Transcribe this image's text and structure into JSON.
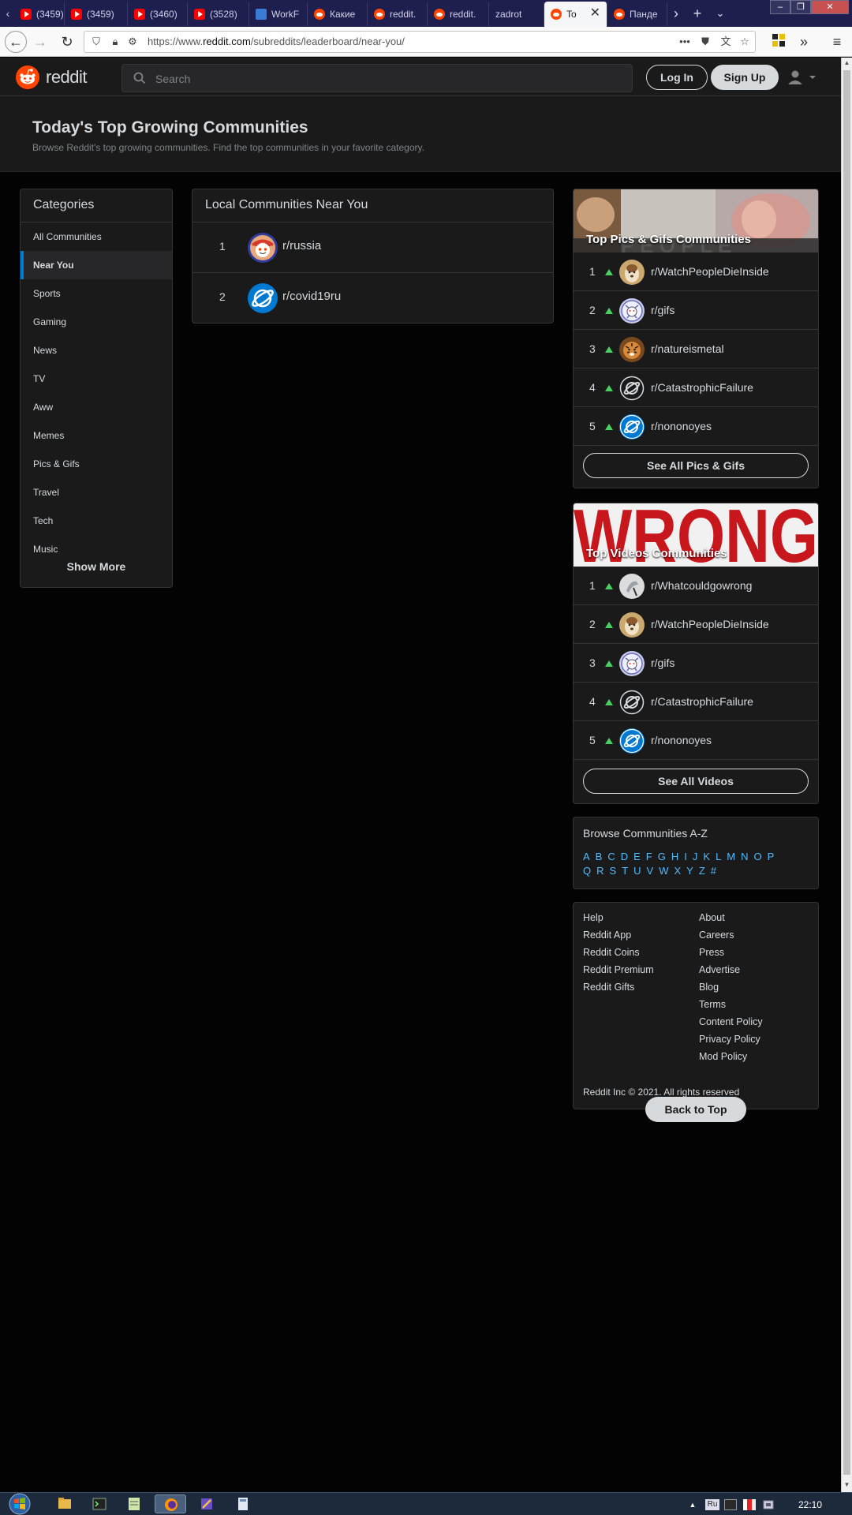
{
  "browser": {
    "tabs": [
      {
        "label": "(3459)",
        "favicon": "youtube-icon"
      },
      {
        "label": "(3459)",
        "favicon": "youtube-icon"
      },
      {
        "label": "(3460)",
        "favicon": "youtube-icon"
      },
      {
        "label": "(3528)",
        "favicon": "youtube-icon"
      },
      {
        "label": "WorkF",
        "favicon": "workflowy-icon"
      },
      {
        "label": "Какие",
        "favicon": "reddit-icon"
      },
      {
        "label": "reddit.",
        "favicon": "reddit-icon"
      },
      {
        "label": "reddit.",
        "favicon": "reddit-icon"
      },
      {
        "label": "zadrot",
        "favicon": ""
      },
      {
        "label": "To",
        "favicon": "reddit-icon"
      },
      {
        "label": "Панде",
        "favicon": "reddit-icon"
      }
    ],
    "active_tab_index": 9,
    "url_domain_prefix": "https://www.",
    "url_domain": "reddit.com",
    "url_path": "/subreddits/leaderboard/near-you/"
  },
  "header": {
    "logo_text": "reddit",
    "search_placeholder": "Search",
    "login_label": "Log In",
    "signup_label": "Sign Up"
  },
  "banner": {
    "title": "Today's Top Growing Communities",
    "subtitle": "Browse Reddit's top growing communities. Find the top communities in your favorite category."
  },
  "categories": {
    "title": "Categories",
    "items": [
      "All Communities",
      "Near You",
      "Sports",
      "Gaming",
      "News",
      "TV",
      "Aww",
      "Memes",
      "Pics & Gifs",
      "Travel",
      "Tech",
      "Music"
    ],
    "active": "Near You",
    "show_more": "Show More"
  },
  "local": {
    "title": "Local Communities Near You",
    "rows": [
      {
        "rank": "1",
        "name": "r/russia"
      },
      {
        "rank": "2",
        "name": "r/covid19ru"
      }
    ]
  },
  "pics": {
    "title": "Top Pics & Gifs Communities",
    "rows": [
      {
        "rank": "1",
        "name": "r/WatchPeopleDieInside"
      },
      {
        "rank": "2",
        "name": "r/gifs"
      },
      {
        "rank": "3",
        "name": "r/natureismetal"
      },
      {
        "rank": "4",
        "name": "r/CatastrophicFailure"
      },
      {
        "rank": "5",
        "name": "r/nononoyes"
      }
    ],
    "see_all": "See All Pics & Gifs"
  },
  "videos": {
    "banner_word": "WRONG",
    "title": "Top Videos Communities",
    "rows": [
      {
        "rank": "1",
        "name": "r/Whatcouldgowrong"
      },
      {
        "rank": "2",
        "name": "r/WatchPeopleDieInside"
      },
      {
        "rank": "3",
        "name": "r/gifs"
      },
      {
        "rank": "4",
        "name": "r/CatastrophicFailure"
      },
      {
        "rank": "5",
        "name": "r/nononoyes"
      }
    ],
    "see_all": "See All Videos"
  },
  "browse": {
    "title": "Browse Communities A-Z",
    "letters_row1": [
      "A",
      "B",
      "C",
      "D",
      "E",
      "F",
      "G",
      "H",
      "I",
      "J",
      "K",
      "L",
      "M",
      "N",
      "O",
      "P"
    ],
    "letters_row2": [
      "Q",
      "R",
      "S",
      "T",
      "U",
      "V",
      "W",
      "X",
      "Y",
      "Z",
      "#"
    ]
  },
  "footer": {
    "left_links": [
      "Help",
      "Reddit App",
      "Reddit Coins",
      "Reddit Premium",
      "Reddit Gifts"
    ],
    "right_links": [
      "About",
      "Careers",
      "Press",
      "Advertise",
      "Blog",
      "Terms",
      "Content Policy",
      "Privacy Policy",
      "Mod Policy"
    ],
    "copyright": "Reddit Inc © 2021. All rights reserved",
    "back_to_top": "Back to Top"
  },
  "taskbar": {
    "language": "Ru",
    "clock": "22:10"
  },
  "colors": {
    "accent_blue": "#0079d3",
    "reddit_orange": "#ff4500",
    "upvote_green": "#46d160",
    "link_blue": "#4fbcff"
  }
}
